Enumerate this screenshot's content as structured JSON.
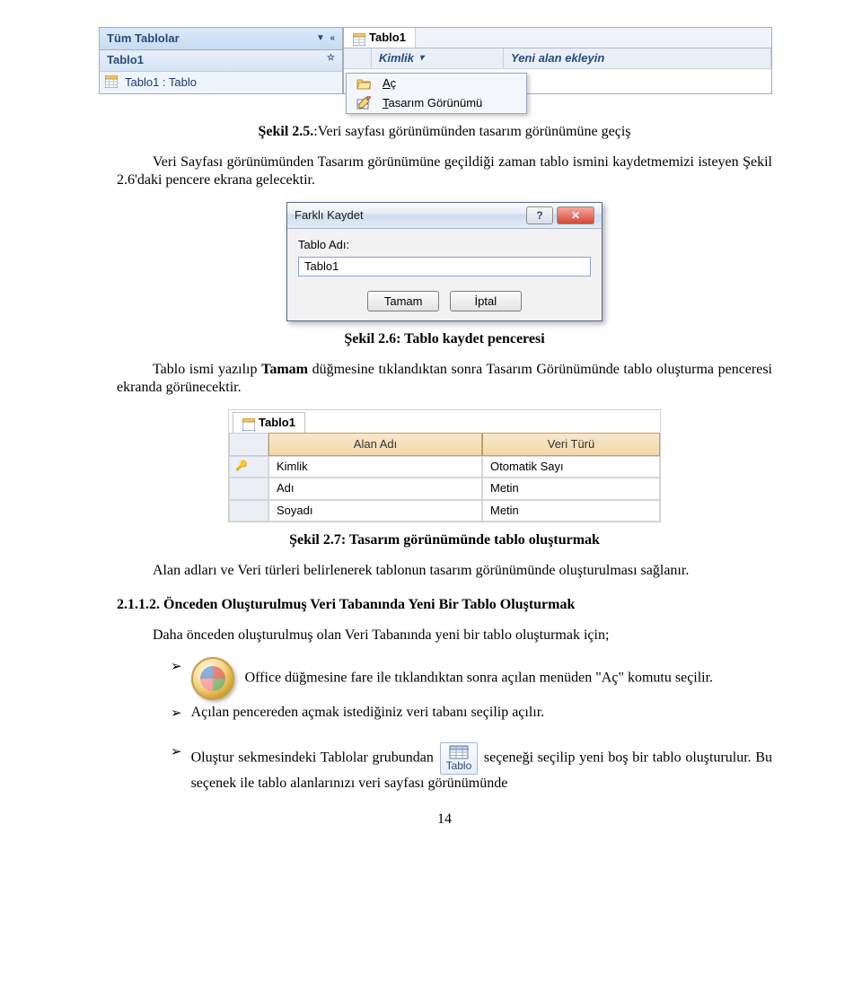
{
  "fig1": {
    "nav_header": "Tüm Tablolar",
    "nav_group": "Tablo1",
    "nav_item": "Tablo1 : Tablo",
    "tab_label": "Tablo1",
    "col_id": "Kimlik",
    "col_add": "Yeni alan ekleyin",
    "menu_open": "Aç",
    "menu_design": "Tasarım Görünümü",
    "menu_open_accel": "A",
    "menu_design_accel": "T"
  },
  "cap1_bold": "Şekil 2.5.",
  "cap1_rest": ":Veri sayfası görünümünden tasarım görünümüne geçiş",
  "p1": "Veri Sayfası görünümünden Tasarım görünümüne geçildiği zaman tablo ismini kaydetmemizi isteyen Şekil 2.6'daki pencere ekrana gelecektir.",
  "dlg": {
    "title": "Farklı Kaydet",
    "label": "Tablo Adı:",
    "value": "Tablo1",
    "ok": "Tamam",
    "cancel": "İptal"
  },
  "cap2": "Şekil 2.6: Tablo kaydet penceresi",
  "p2a": "Tablo ismi yazılıp ",
  "p2b_bold": "Tamam",
  "p2c": " düğmesine tıklandıktan sonra Tasarım Görünümünde tablo oluşturma penceresi ekranda görünecektir.",
  "fig3": {
    "tab": "Tablo1",
    "head_name": "Alan Adı",
    "head_type": "Veri Türü",
    "rows": [
      {
        "name": "Kimlik",
        "type": "Otomatik Sayı",
        "pk": true
      },
      {
        "name": "Adı",
        "type": "Metin",
        "pk": false
      },
      {
        "name": "Soyadı",
        "type": "Metin",
        "pk": false
      }
    ]
  },
  "cap3": "Şekil 2.7: Tasarım görünümünde tablo oluşturmak",
  "p3": "Alan adları ve Veri türleri belirlenerek tablonun tasarım görünümünde oluşturulması sağlanır.",
  "h3": "2.1.1.2. Önceden Oluşturulmuş Veri Tabanında Yeni Bir Tablo Oluşturmak",
  "p4": "Daha önceden oluşturulmuş olan Veri Tabanında yeni bir tablo oluşturmak için;",
  "b1a": "Office düğmesine fare ile tıklandıktan sonra açılan menüden \"Aç\" komutu seçilir.",
  "b2": "Açılan pencereden açmak istediğiniz veri tabanı seçilip açılır.",
  "b3a": "Oluştur sekmesindeki Tablolar grubundan ",
  "b3_btn": "Tablo",
  "b3b": " seçeneği seçilip yeni boş bir tablo oluşturulur. Bu seçenek ile tablo alanlarınızı veri sayfası görünümünde",
  "page_num": "14"
}
